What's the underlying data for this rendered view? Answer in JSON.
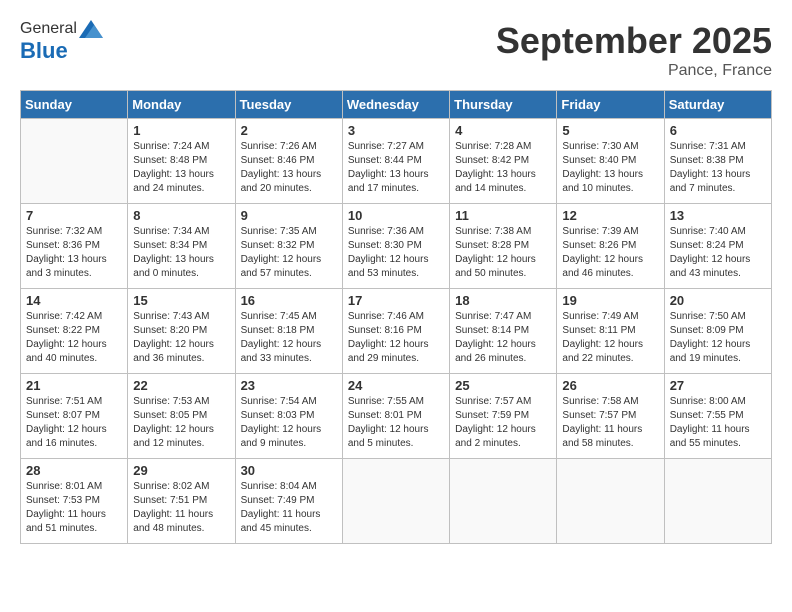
{
  "logo": {
    "general": "General",
    "blue": "Blue"
  },
  "title": "September 2025",
  "subtitle": "Pance, France",
  "days_of_week": [
    "Sunday",
    "Monday",
    "Tuesday",
    "Wednesday",
    "Thursday",
    "Friday",
    "Saturday"
  ],
  "weeks": [
    [
      {
        "day": "",
        "info": ""
      },
      {
        "day": "1",
        "info": "Sunrise: 7:24 AM\nSunset: 8:48 PM\nDaylight: 13 hours\nand 24 minutes."
      },
      {
        "day": "2",
        "info": "Sunrise: 7:26 AM\nSunset: 8:46 PM\nDaylight: 13 hours\nand 20 minutes."
      },
      {
        "day": "3",
        "info": "Sunrise: 7:27 AM\nSunset: 8:44 PM\nDaylight: 13 hours\nand 17 minutes."
      },
      {
        "day": "4",
        "info": "Sunrise: 7:28 AM\nSunset: 8:42 PM\nDaylight: 13 hours\nand 14 minutes."
      },
      {
        "day": "5",
        "info": "Sunrise: 7:30 AM\nSunset: 8:40 PM\nDaylight: 13 hours\nand 10 minutes."
      },
      {
        "day": "6",
        "info": "Sunrise: 7:31 AM\nSunset: 8:38 PM\nDaylight: 13 hours\nand 7 minutes."
      }
    ],
    [
      {
        "day": "7",
        "info": "Sunrise: 7:32 AM\nSunset: 8:36 PM\nDaylight: 13 hours\nand 3 minutes."
      },
      {
        "day": "8",
        "info": "Sunrise: 7:34 AM\nSunset: 8:34 PM\nDaylight: 13 hours\nand 0 minutes."
      },
      {
        "day": "9",
        "info": "Sunrise: 7:35 AM\nSunset: 8:32 PM\nDaylight: 12 hours\nand 57 minutes."
      },
      {
        "day": "10",
        "info": "Sunrise: 7:36 AM\nSunset: 8:30 PM\nDaylight: 12 hours\nand 53 minutes."
      },
      {
        "day": "11",
        "info": "Sunrise: 7:38 AM\nSunset: 8:28 PM\nDaylight: 12 hours\nand 50 minutes."
      },
      {
        "day": "12",
        "info": "Sunrise: 7:39 AM\nSunset: 8:26 PM\nDaylight: 12 hours\nand 46 minutes."
      },
      {
        "day": "13",
        "info": "Sunrise: 7:40 AM\nSunset: 8:24 PM\nDaylight: 12 hours\nand 43 minutes."
      }
    ],
    [
      {
        "day": "14",
        "info": "Sunrise: 7:42 AM\nSunset: 8:22 PM\nDaylight: 12 hours\nand 40 minutes."
      },
      {
        "day": "15",
        "info": "Sunrise: 7:43 AM\nSunset: 8:20 PM\nDaylight: 12 hours\nand 36 minutes."
      },
      {
        "day": "16",
        "info": "Sunrise: 7:45 AM\nSunset: 8:18 PM\nDaylight: 12 hours\nand 33 minutes."
      },
      {
        "day": "17",
        "info": "Sunrise: 7:46 AM\nSunset: 8:16 PM\nDaylight: 12 hours\nand 29 minutes."
      },
      {
        "day": "18",
        "info": "Sunrise: 7:47 AM\nSunset: 8:14 PM\nDaylight: 12 hours\nand 26 minutes."
      },
      {
        "day": "19",
        "info": "Sunrise: 7:49 AM\nSunset: 8:11 PM\nDaylight: 12 hours\nand 22 minutes."
      },
      {
        "day": "20",
        "info": "Sunrise: 7:50 AM\nSunset: 8:09 PM\nDaylight: 12 hours\nand 19 minutes."
      }
    ],
    [
      {
        "day": "21",
        "info": "Sunrise: 7:51 AM\nSunset: 8:07 PM\nDaylight: 12 hours\nand 16 minutes."
      },
      {
        "day": "22",
        "info": "Sunrise: 7:53 AM\nSunset: 8:05 PM\nDaylight: 12 hours\nand 12 minutes."
      },
      {
        "day": "23",
        "info": "Sunrise: 7:54 AM\nSunset: 8:03 PM\nDaylight: 12 hours\nand 9 minutes."
      },
      {
        "day": "24",
        "info": "Sunrise: 7:55 AM\nSunset: 8:01 PM\nDaylight: 12 hours\nand 5 minutes."
      },
      {
        "day": "25",
        "info": "Sunrise: 7:57 AM\nSunset: 7:59 PM\nDaylight: 12 hours\nand 2 minutes."
      },
      {
        "day": "26",
        "info": "Sunrise: 7:58 AM\nSunset: 7:57 PM\nDaylight: 11 hours\nand 58 minutes."
      },
      {
        "day": "27",
        "info": "Sunrise: 8:00 AM\nSunset: 7:55 PM\nDaylight: 11 hours\nand 55 minutes."
      }
    ],
    [
      {
        "day": "28",
        "info": "Sunrise: 8:01 AM\nSunset: 7:53 PM\nDaylight: 11 hours\nand 51 minutes."
      },
      {
        "day": "29",
        "info": "Sunrise: 8:02 AM\nSunset: 7:51 PM\nDaylight: 11 hours\nand 48 minutes."
      },
      {
        "day": "30",
        "info": "Sunrise: 8:04 AM\nSunset: 7:49 PM\nDaylight: 11 hours\nand 45 minutes."
      },
      {
        "day": "",
        "info": ""
      },
      {
        "day": "",
        "info": ""
      },
      {
        "day": "",
        "info": ""
      },
      {
        "day": "",
        "info": ""
      }
    ]
  ]
}
